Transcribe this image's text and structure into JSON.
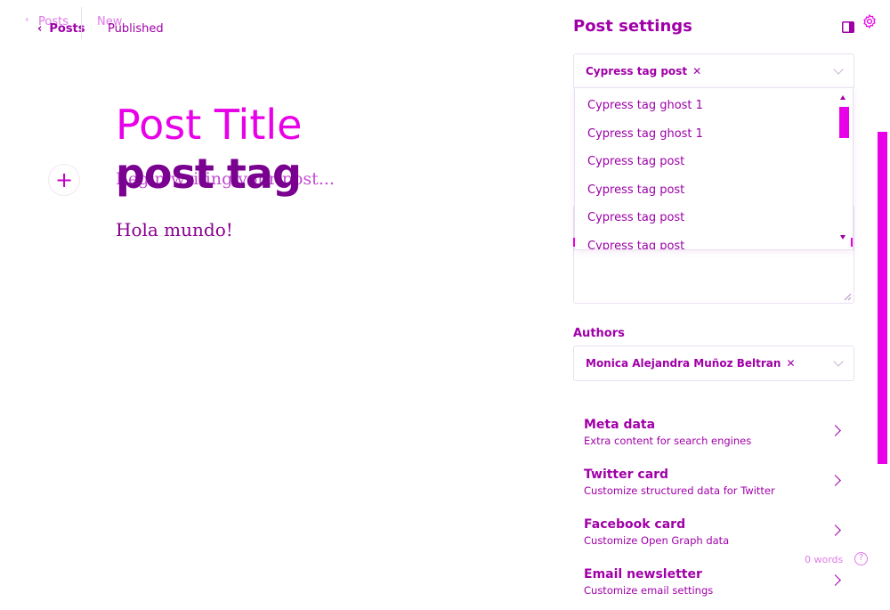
{
  "header": {
    "back_ghost_label": "Posts",
    "back_label": "Posts",
    "status_ghost": "New",
    "status": "Published"
  },
  "editor": {
    "title_placeholder": "Post Title",
    "title_value": "post tag",
    "excerpt_placeholder": "Begin writing your post...",
    "body": "Hola mundo!",
    "add_icon": "plus-icon"
  },
  "settings": {
    "title": "Post settings",
    "icons": {
      "toggle": "sidebar-toggle-icon",
      "gear": "gear-icon"
    },
    "tags_selected": "Cypress tag post",
    "tags_dropdown": [
      "Cypress tag ghost 1",
      "Cypress tag ghost 1",
      "Cypress tag post",
      "Cypress tag post",
      "Cypress tag post",
      "Cypress tag post"
    ],
    "authors_label": "Authors",
    "author_selected": "Monica Alejandra Muñoz Beltran",
    "links": [
      {
        "title": "Meta data",
        "subtitle": "Extra content for search engines"
      },
      {
        "title": "Twitter card",
        "subtitle": "Customize structured data for Twitter"
      },
      {
        "title": "Facebook card",
        "subtitle": "Customize Open Graph data"
      },
      {
        "title": "Email newsletter",
        "subtitle": "Customize email settings"
      }
    ]
  },
  "footer": {
    "word_count": "0 words",
    "help_icon": "help-icon"
  },
  "colors": {
    "accent": "#a000a8",
    "bright": "#e800e8",
    "dark": "#7a0090"
  }
}
